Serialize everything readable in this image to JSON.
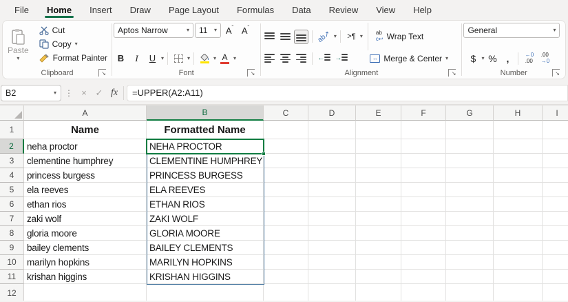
{
  "menu": {
    "tabs": [
      "File",
      "Home",
      "Insert",
      "Draw",
      "Page Layout",
      "Formulas",
      "Data",
      "Review",
      "View",
      "Help"
    ],
    "active": "Home"
  },
  "ribbon": {
    "clipboard": {
      "label": "Clipboard",
      "paste": "Paste",
      "cut": "Cut",
      "copy": "Copy",
      "format_painter": "Format Painter"
    },
    "font": {
      "label": "Font",
      "font_name": "Aptos Narrow",
      "font_size": "11",
      "bold": "B",
      "italic": "I",
      "underline": "U"
    },
    "alignment": {
      "label": "Alignment",
      "wrap_text": "Wrap Text",
      "merge_center": "Merge & Center",
      "pilcrow": "¶",
      "orientation": "ab"
    },
    "number": {
      "label": "Number",
      "format": "General",
      "currency": "$",
      "percent": "%",
      "comma": ",",
      "inc_dec_top": "←0",
      "inc_dec_bot": ".00",
      "dec_dec_top": ".00",
      "dec_dec_bot": "→0"
    }
  },
  "formula_bar": {
    "name_box": "B2",
    "cancel": "×",
    "enter": "✓",
    "fx": "fx",
    "dots": "⋮",
    "formula": "=UPPER(A2:A11)"
  },
  "icons": {
    "dropdown": "▾",
    "dialog_launcher": "↘",
    "scissors": "✂",
    "wrap_top": "ab",
    "wrap_bot": "c↩",
    "merge_arrows": "↔",
    "orientation_arrow": "ab↗",
    "text_direction": "¶"
  },
  "grid": {
    "columns": [
      "A",
      "B",
      "C",
      "D",
      "E",
      "F",
      "G",
      "H",
      "I"
    ],
    "active_cell": "B2",
    "selected_column": "B",
    "selected_row": "2",
    "spill_range": "B2:B11",
    "rows": [
      {
        "n": "1",
        "style": "header",
        "cells": {
          "A": "Name",
          "B": "Formatted Name"
        }
      },
      {
        "n": "2",
        "cells": {
          "A": "neha proctor",
          "B": "NEHA PROCTOR"
        }
      },
      {
        "n": "3",
        "cells": {
          "A": "clementine humphrey",
          "B": "CLEMENTINE HUMPHREY"
        }
      },
      {
        "n": "4",
        "cells": {
          "A": "princess burgess",
          "B": "PRINCESS BURGESS"
        }
      },
      {
        "n": "5",
        "cells": {
          "A": "ela reeves",
          "B": "ELA REEVES"
        }
      },
      {
        "n": "6",
        "cells": {
          "A": "ethan rios",
          "B": "ETHAN RIOS"
        }
      },
      {
        "n": "7",
        "cells": {
          "A": "zaki wolf",
          "B": "ZAKI WOLF"
        }
      },
      {
        "n": "8",
        "cells": {
          "A": "gloria moore",
          "B": "GLORIA MOORE"
        }
      },
      {
        "n": "9",
        "cells": {
          "A": "bailey clements",
          "B": "BAILEY CLEMENTS"
        }
      },
      {
        "n": "10",
        "cells": {
          "A": "marilyn hopkins",
          "B": "MARILYN HOPKINS"
        }
      },
      {
        "n": "11",
        "cells": {
          "A": "krishan higgins",
          "B": "KRISHAN HIGGINS"
        }
      },
      {
        "n": "12",
        "cells": {}
      }
    ]
  },
  "colors": {
    "accent_green": "#107c41",
    "spill_border": "#4f7ca3",
    "selected_header_bg": "#d8d8d6",
    "fill_yellow": "#ffe400",
    "font_red": "#e03c31",
    "icon_blue": "#3b6db5"
  }
}
